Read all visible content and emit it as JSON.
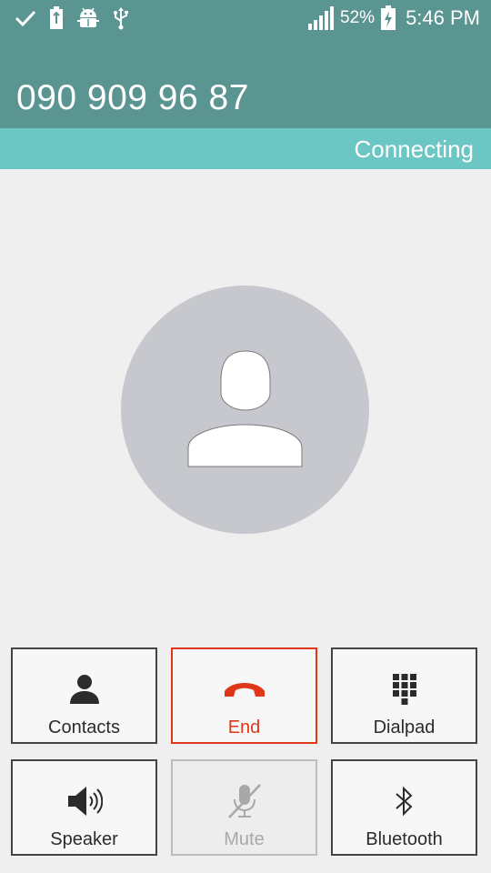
{
  "status_bar": {
    "battery_percent": "52%",
    "time": "5:46 PM",
    "left_icons": [
      "check-icon",
      "battery-saver-icon",
      "android-debug-icon",
      "usb-icon"
    ],
    "right_icons": [
      "signal-icon",
      "battery-charging-icon"
    ]
  },
  "call": {
    "number": "090 909 96 87",
    "status": "Connecting"
  },
  "contact": {
    "avatar_icon": "person-placeholder-icon"
  },
  "actions": [
    {
      "label": "Contacts",
      "icon": "contacts-icon",
      "state": "normal"
    },
    {
      "label": "End",
      "icon": "end-call-icon",
      "state": "highlight"
    },
    {
      "label": "Dialpad",
      "icon": "dialpad-icon",
      "state": "normal"
    },
    {
      "label": "Speaker",
      "icon": "speaker-icon",
      "state": "normal"
    },
    {
      "label": "Mute",
      "icon": "mute-icon",
      "state": "disabled"
    },
    {
      "label": "Bluetooth",
      "icon": "bluetooth-icon",
      "state": "normal"
    }
  ],
  "colors": {
    "header": "#5a9592",
    "status_band": "#6cc6c4",
    "end_accent": "#e0371a",
    "avatar_bg": "#c6c8cd"
  }
}
